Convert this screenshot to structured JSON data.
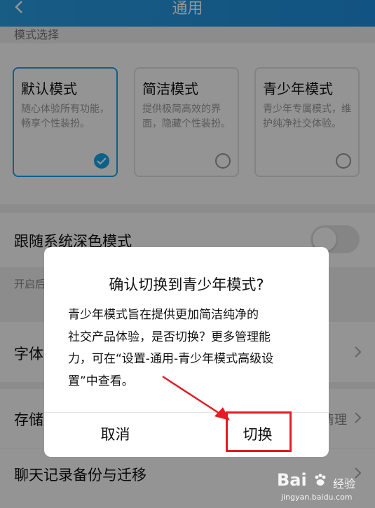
{
  "header": {
    "title": "通用"
  },
  "mode_section": {
    "label": "模式选择",
    "cards": [
      {
        "title": "默认模式",
        "desc": "随心体验所有功能，畅享个性装扮。",
        "selected": true
      },
      {
        "title": "简洁模式",
        "desc": "提供极简高效的界面，隐藏个性装扮。",
        "selected": false
      },
      {
        "title": "青少年模式",
        "desc": "青少年专属模式，维护纯净社交体验。",
        "selected": false
      }
    ]
  },
  "settings": {
    "dark_mode": {
      "label": "跟随系统深色模式",
      "sub": "开启后",
      "enabled": false
    },
    "font": {
      "label": "字体"
    },
    "storage": {
      "label": "存储",
      "hint": "清理"
    },
    "chat_backup": {
      "label": "聊天记录备份与迁移"
    }
  },
  "dialog": {
    "title": "确认切换到青少年模式?",
    "message_lines": [
      "青少年模式旨在提供更加简洁纯净的",
      "社交产品体验，是否切换？更多管理能",
      "力，可在“设置-通用-青少年模式高级设",
      "置”中查看。"
    ],
    "cancel_label": "取消",
    "confirm_label": "切换"
  },
  "watermark": {
    "brand": "Bai",
    "suffix": "经验",
    "url": "jingyan.baidu.com"
  },
  "colors": {
    "accent": "#12a7ee",
    "header": "#1e8fe0",
    "annotation": "#e31b23"
  }
}
